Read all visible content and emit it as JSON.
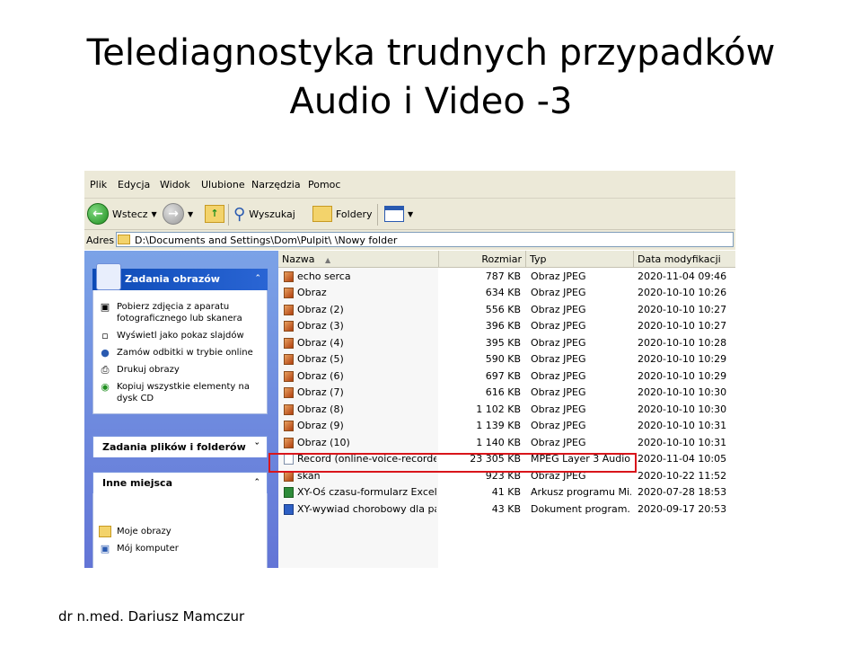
{
  "slide": {
    "title_line1": "Telediagnostyka trudnych przypadków",
    "title_line2": "Audio i Video -3",
    "footer": "dr n.med. Dariusz Mamczur"
  },
  "menu": [
    "Plik",
    "Edycja",
    "Widok",
    "Ulubione",
    "Narzędzia",
    "Pomoc"
  ],
  "toolbar": {
    "back_label": "Wstecz",
    "search_label": "Wyszukaj",
    "folders_label": "Foldery"
  },
  "address": {
    "label": "Adres",
    "value": "D:\\Documents and Settings\\Dom\\Pulpit\\  \\Nowy folder"
  },
  "left_pane": {
    "picture_tasks": {
      "title": "Zadania obrazów",
      "items": [
        "Pobierz zdjęcia z aparatu fotograficznego lub skanera",
        "Wyświetl jako pokaz slajdów",
        "Zamów odbitki w trybie online",
        "Drukuj obrazy",
        "Kopiuj wszystkie elementy na dysk CD"
      ]
    },
    "file_tasks": {
      "title": "Zadania plików i folderów"
    },
    "other_places": {
      "title": "Inne miejsca",
      "items": [
        "Moje obrazy",
        "Mój komputer"
      ]
    }
  },
  "columns": {
    "name": "Nazwa",
    "size": "Rozmiar",
    "type": "Typ",
    "date": "Data modyfikacji"
  },
  "files": [
    {
      "icon": "jpeg",
      "name": "echo serca",
      "size": "787 KB",
      "type": "Obraz JPEG",
      "date": "2020-11-04 09:46"
    },
    {
      "icon": "jpeg",
      "name": "Obraz",
      "size": "634 KB",
      "type": "Obraz JPEG",
      "date": "2020-10-10 10:26"
    },
    {
      "icon": "jpeg",
      "name": "Obraz (2)",
      "size": "556 KB",
      "type": "Obraz JPEG",
      "date": "2020-10-10 10:27"
    },
    {
      "icon": "jpeg",
      "name": "Obraz (3)",
      "size": "396 KB",
      "type": "Obraz JPEG",
      "date": "2020-10-10 10:27"
    },
    {
      "icon": "jpeg",
      "name": "Obraz (4)",
      "size": "395 KB",
      "type": "Obraz JPEG",
      "date": "2020-10-10 10:28"
    },
    {
      "icon": "jpeg",
      "name": "Obraz (5)",
      "size": "590 KB",
      "type": "Obraz JPEG",
      "date": "2020-10-10 10:29"
    },
    {
      "icon": "jpeg",
      "name": "Obraz (6)",
      "size": "697 KB",
      "type": "Obraz JPEG",
      "date": "2020-10-10 10:29"
    },
    {
      "icon": "jpeg",
      "name": "Obraz (7)",
      "size": "616 KB",
      "type": "Obraz JPEG",
      "date": "2020-10-10 10:30"
    },
    {
      "icon": "jpeg",
      "name": "Obraz (8)",
      "size": "1 102 KB",
      "type": "Obraz JPEG",
      "date": "2020-10-10 10:30"
    },
    {
      "icon": "jpeg",
      "name": "Obraz (9)",
      "size": "1 139 KB",
      "type": "Obraz JPEG",
      "date": "2020-10-10 10:31"
    },
    {
      "icon": "jpeg",
      "name": "Obraz (10)",
      "size": "1 140 KB",
      "type": "Obraz JPEG",
      "date": "2020-10-10 10:31"
    },
    {
      "icon": "mp3",
      "name": "Record (online-voice-recorder...",
      "size": "23 305 KB",
      "type": "MPEG Layer 3 Audio...",
      "date": "2020-11-04 10:05"
    },
    {
      "icon": "jpeg",
      "name": "skan",
      "size": "923 KB",
      "type": "Obraz JPEG",
      "date": "2020-10-22 11:52"
    },
    {
      "icon": "xls",
      "name": "XY-Oś czasu-formularz Excel_KM",
      "size": "41 KB",
      "type": "Arkusz programu Mi...",
      "date": "2020-07-28 18:53"
    },
    {
      "icon": "doc",
      "name": "XY-wywiad chorobowy dla pa...",
      "size": "43 KB",
      "type": "Dokument program...",
      "date": "2020-09-17 20:53"
    }
  ]
}
